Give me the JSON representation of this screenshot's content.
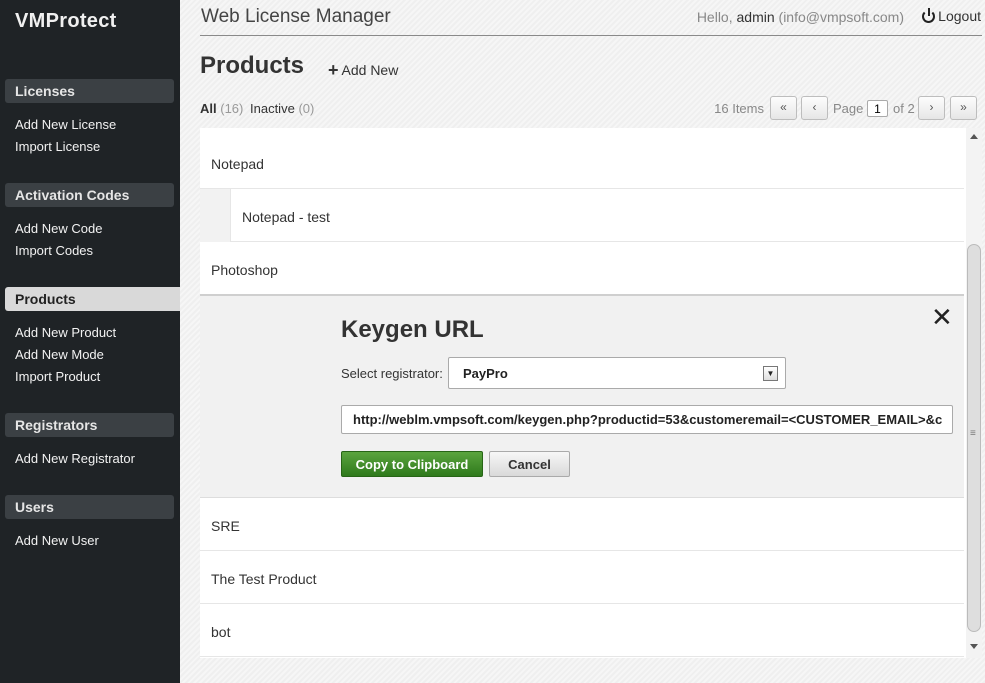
{
  "sidebar": {
    "brand": "VMProtect",
    "sections": [
      {
        "title": "Licenses",
        "items": [
          "Add New License",
          "Import License"
        ]
      },
      {
        "title": "Activation Codes",
        "items": [
          "Add New Code",
          "Import Codes"
        ]
      },
      {
        "title": "Products",
        "items": [
          "Add New Product",
          "Add New Mode",
          "Import Product"
        ]
      },
      {
        "title": "Registrators",
        "items": [
          "Add New Registrator"
        ]
      },
      {
        "title": "Users",
        "items": [
          "Add New User"
        ]
      }
    ]
  },
  "header": {
    "app_title": "Web License Manager",
    "hello": "Hello,",
    "username": "admin",
    "email": "(info@vmpsoft.com)",
    "logout": "Logout"
  },
  "page": {
    "title": "Products",
    "add_new": "Add New",
    "filters": {
      "all_label": "All",
      "all_count": "(16)",
      "inactive_label": "Inactive",
      "inactive_count": "(0)"
    },
    "pagination": {
      "items": "16 Items",
      "first": "«",
      "prev": "‹",
      "page_label": "Page",
      "current_page": "1",
      "of_label": "of 2",
      "next": "›",
      "last": "»"
    }
  },
  "products": [
    {
      "name": "Notepad"
    },
    {
      "name": "Notepad - test"
    },
    {
      "name": "Photoshop"
    },
    {
      "name": "SRE"
    },
    {
      "name": "The Test Product"
    },
    {
      "name": "bot"
    }
  ],
  "keygen": {
    "title": "Keygen URL",
    "registrator_label": "Select registrator:",
    "registrator_value": "PayPro",
    "url": "http://weblm.vmpsoft.com/keygen.php?productid=53&customeremail=<CUSTOMER_EMAIL>&c",
    "copy_button": "Copy to Clipboard",
    "cancel_button": "Cancel",
    "close": "✕"
  }
}
